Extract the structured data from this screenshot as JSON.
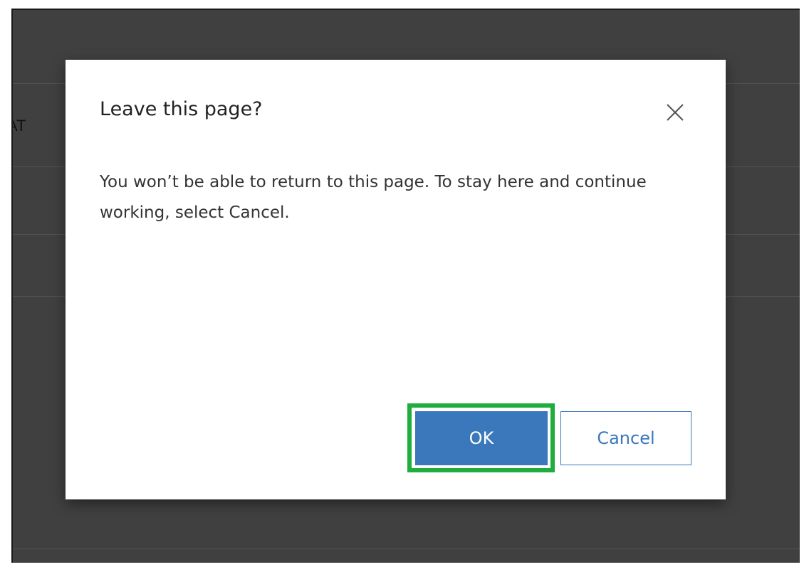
{
  "background": {
    "partial_label": "AT"
  },
  "dialog": {
    "title": "Leave this page?",
    "message": "You won’t be able to return to this page. To stay here and continue working, select Cancel.",
    "close_icon": "close-icon",
    "ok_label": "OK",
    "cancel_label": "Cancel"
  },
  "colors": {
    "backdrop": "#404040",
    "accent": "#3a78bb",
    "highlight": "#1fae3e"
  }
}
